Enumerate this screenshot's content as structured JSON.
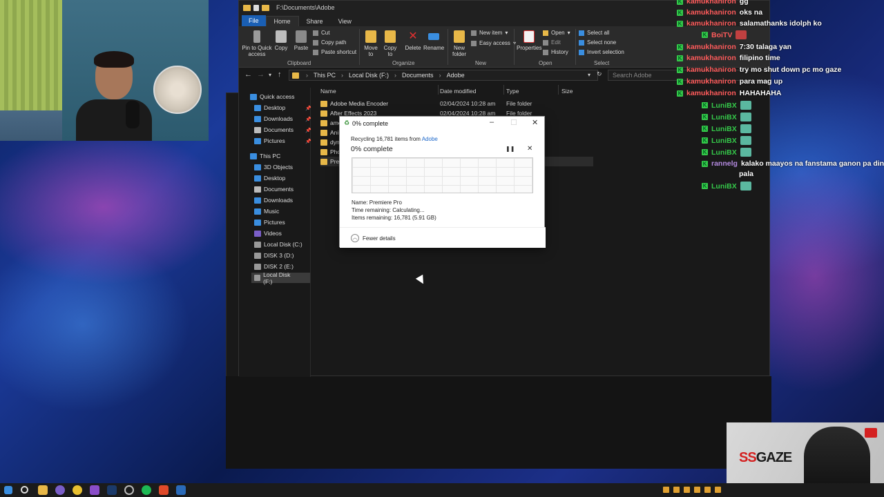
{
  "explorer": {
    "title_path": "F:\\Documents\\Adobe",
    "tabs": [
      "File",
      "Home",
      "Share",
      "View"
    ],
    "ribbon": {
      "pin_label": "Pin to Quick access",
      "copy_label": "Copy",
      "paste_label": "Paste",
      "cut_label": "Cut",
      "copy_path_label": "Copy path",
      "paste_shortcut_label": "Paste shortcut",
      "clipboard_group": "Clipboard",
      "move_to_label": "Move to",
      "copy_to_label": "Copy to",
      "delete_label": "Delete",
      "rename_label": "Rename",
      "organize_group": "Organize",
      "new_folder_label": "New folder",
      "new_item_label": "New item",
      "easy_access_label": "Easy access",
      "new_group": "New",
      "properties_label": "Properties",
      "open_label": "Open",
      "edit_label": "Edit",
      "history_label": "History",
      "open_group": "Open",
      "select_all_label": "Select all",
      "select_none_label": "Select none",
      "invert_selection_label": "Invert selection",
      "select_group": "Select"
    },
    "breadcrumb": [
      "This PC",
      "Local Disk (F:)",
      "Documents",
      "Adobe"
    ],
    "search_placeholder": "Search Adobe",
    "nav": {
      "quick_access": "Quick access",
      "quick_items": [
        "Desktop",
        "Downloads",
        "Documents",
        "Pictures"
      ],
      "this_pc": "This PC",
      "pc_items": [
        "3D Objects",
        "Desktop",
        "Documents",
        "Downloads",
        "Music",
        "Pictures",
        "Videos",
        "Local Disk (C:)",
        "DISK 3 (D:)",
        "DISK 2 (E:)",
        "Local Disk (F:)"
      ]
    },
    "columns": {
      "name": "Name",
      "date": "Date modified",
      "type": "Type",
      "size": "Size"
    },
    "files": [
      {
        "name": "Adobe Media Encoder",
        "date": "02/04/2024 10:28 am",
        "type": "File folder"
      },
      {
        "name": "After Effects 2023",
        "date": "02/04/2024 10:28 am",
        "type": "File folder"
      },
      {
        "name": "ame",
        "date": "",
        "type": ""
      },
      {
        "name": "Ani",
        "date": "",
        "type": ""
      },
      {
        "name": "dyn",
        "date": "",
        "type": ""
      },
      {
        "name": "Pho",
        "date": "",
        "type": ""
      },
      {
        "name": "Pre",
        "date": "",
        "type": ""
      }
    ]
  },
  "dialog": {
    "title": "0% complete",
    "recycling_prefix": "Recycling 16,781 items from ",
    "recycling_source": "Adobe",
    "percent": "0% complete",
    "progress": 0,
    "name_line": "Name:  Premiere Pro",
    "time_line": "Time remaining:  Calculating...",
    "items_line": "Items remaining:  16,781 (5.91 GB)",
    "fewer_details": "Fewer details"
  },
  "chat": [
    {
      "user": "kamukhaniron",
      "msg": "gg"
    },
    {
      "user": "kamukhaniron",
      "msg": "oks na"
    },
    {
      "user": "kamukhaniron",
      "msg": "salamathanks idolph ko"
    },
    {
      "user": "BoiTV",
      "msg": ""
    },
    {
      "user": "kamukhaniron",
      "msg": "7:30 talaga yan"
    },
    {
      "user": "kamukhaniron",
      "msg": "filipino time"
    },
    {
      "user": "kamukhaniron",
      "msg": "try mo shut down pc mo gaze"
    },
    {
      "user": "kamukhaniron",
      "msg": "para mag up"
    },
    {
      "user": "kamukhaniron",
      "msg": "HAHAHAHA"
    },
    {
      "user": "LuniBX",
      "msg": ""
    },
    {
      "user": "LuniBX",
      "msg": ""
    },
    {
      "user": "LuniBX",
      "msg": ""
    },
    {
      "user": "LuniBX",
      "msg": ""
    },
    {
      "user": "LuniBX",
      "msg": ""
    },
    {
      "user": "rannelg",
      "msg": "kalako maayos na fanstama ganon pa din"
    },
    {
      "user": "",
      "msg": "pala"
    },
    {
      "user": "LuniBX",
      "msg": ""
    }
  ],
  "overlay": {
    "brand_ss": "SS",
    "brand_rest": "GAZE"
  },
  "colors": {
    "accent": "#1a5fb4",
    "folder": "#e8b848",
    "badge": "#35c94a",
    "chat_user": "#ff5b5b",
    "luni": "#35c94a"
  }
}
